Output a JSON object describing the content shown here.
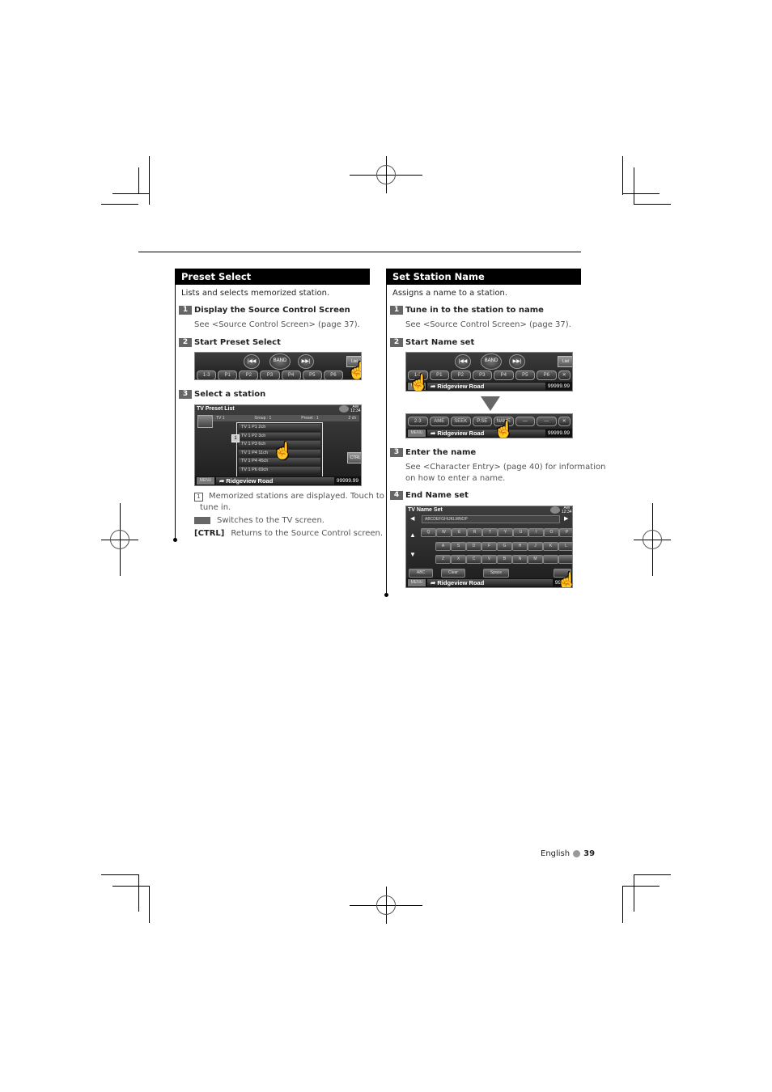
{
  "left": {
    "title": "Preset Select",
    "intro": "Lists and selects memorized station.",
    "steps": [
      {
        "num": "1",
        "title": "Display the Source Control Screen",
        "detail": "See <Source Control Screen> (page 37)."
      },
      {
        "num": "2",
        "title": "Start Preset Select"
      },
      {
        "num": "3",
        "title": "Select a station"
      }
    ],
    "screen_control": {
      "buttons": {
        "prev": "|◀◀",
        "band": "BAND",
        "next": "▶▶|",
        "list": "List"
      },
      "presets": [
        "1-3",
        "P1",
        "P2",
        "P3",
        "P4",
        "P5",
        "P6"
      ]
    },
    "screen_preset_list": {
      "title": "TV Preset List",
      "clock_ampm": "AM",
      "clock_time": "12:34",
      "header": {
        "band": "TV 1",
        "group": "Group : 1",
        "preset": "Preset : 1",
        "channel": "2 ch"
      },
      "rows": [
        "TV 1 P1 2ch",
        "TV 1 P2 3ch",
        "TV 1 P3 6ch",
        "TV 1 P4 11ch",
        "TV 1 P4 45ch",
        "TV 1 P6 69ch"
      ],
      "marker": "1",
      "ctrl": "CTRL",
      "menu": "MENU",
      "road": "Ridgeview Road",
      "freq": "99999.99"
    },
    "notes": [
      {
        "key": "1",
        "text": "Memorized stations are displayed. Touch to",
        "text2": "tune in."
      },
      {
        "key": "[ ]",
        "text": "Switches to the TV screen."
      },
      {
        "key": "[CTRL]",
        "text": "Returns to the Source Control screen."
      }
    ]
  },
  "right": {
    "title": "Set Station Name",
    "intro": "Assigns a name to a station.",
    "steps": [
      {
        "num": "1",
        "title": "Tune in to the station to name",
        "detail": "See <Source Control Screen> (page 37)."
      },
      {
        "num": "2",
        "title": "Start Name set"
      },
      {
        "num": "3",
        "title": "Enter the name",
        "detail": "See <Character Entry> (page 40) for information",
        "detail2": "on how to enter a name."
      },
      {
        "num": "4",
        "title": "End Name set"
      }
    ],
    "screen_control": {
      "buttons": {
        "prev": "|◀◀",
        "band": "BAND",
        "next": "▶▶|",
        "list": "List"
      },
      "presets": [
        "1-3",
        "P1",
        "P2",
        "P3",
        "P4",
        "P5",
        "P6",
        "✕"
      ],
      "menu": "MENU",
      "road": "Ridgeview Road",
      "freq": "99999.99"
    },
    "screen_function": {
      "buttons": [
        "2-3",
        "AME",
        "SEEK",
        "P.SE",
        "NAME",
        "—",
        "—",
        "✕"
      ],
      "menu": "MENU",
      "road": "Ridgeview Road",
      "freq": "99999.99"
    },
    "screen_name_set": {
      "title": "TV Name Set",
      "clock_ampm": "AM",
      "clock_time": "12:34",
      "input_value": "ABCDEFGHIJKLMNOP",
      "row1": [
        "Q",
        "W",
        "E",
        "R",
        "T",
        "Y",
        "U",
        "I",
        "O",
        "P"
      ],
      "row2": [
        "A",
        "S",
        "D",
        "F",
        "G",
        "H",
        "J",
        "K",
        "L"
      ],
      "row3": [
        "Z",
        "X",
        "C",
        "V",
        "B",
        "N",
        "M",
        "",
        ""
      ],
      "abc": "ABC",
      "clear": "Clear",
      "space": "Space",
      "menu": "MENU",
      "road": "Ridgeview Road",
      "freq": "99999"
    }
  },
  "footer": {
    "language": "English",
    "page": "39"
  }
}
